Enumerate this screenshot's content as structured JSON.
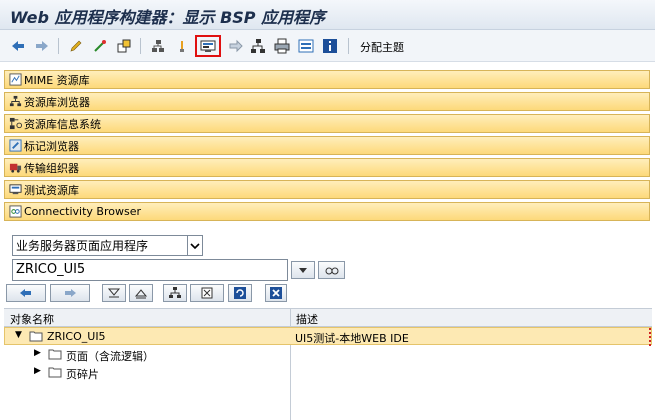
{
  "window": {
    "title": "Web 应用程序构建器：显示 BSP 应用程序"
  },
  "toolbar": {
    "icons": [
      "back-arrow-icon",
      "forward-arrow-icon",
      "edit-pencil-icon",
      "wand-icon",
      "object-list-icon",
      "hierarchy-icon",
      "lightbulb-icon",
      "test-monitor-icon",
      "navigation-icon",
      "tree-structure-icon",
      "printer-icon",
      "display-object-icon",
      "info-icon"
    ],
    "assign_theme_label": "分配主题"
  },
  "nav": {
    "items": [
      {
        "label": "MIME 资源库",
        "icon": "mime-repository-icon"
      },
      {
        "label": "资源库浏览器",
        "icon": "repository-browser-icon"
      },
      {
        "label": "资源库信息系统",
        "icon": "repository-info-system-icon"
      },
      {
        "label": "标记浏览器",
        "icon": "tag-browser-icon"
      },
      {
        "label": "传输组织器",
        "icon": "transport-organizer-icon"
      },
      {
        "label": "测试资源库",
        "icon": "test-repository-icon"
      },
      {
        "label": "Connectivity Browser",
        "icon": "connectivity-browser-icon"
      }
    ]
  },
  "object_type": {
    "selected": "业务服务器页面应用程序"
  },
  "object_name": {
    "value": "ZRICO_UI5"
  },
  "tree": {
    "headers": {
      "name": "对象名称",
      "description": "描述"
    },
    "rows": [
      {
        "name": "ZRICO_UI5",
        "description": "UI5测试-本地WEB IDE"
      },
      {
        "name": "页面（含流逻辑）",
        "description": ""
      },
      {
        "name": "页碎片",
        "description": ""
      }
    ]
  },
  "colors": {
    "nav_bar": "#fdd97a",
    "highlight_row": "#fde9b3",
    "selection_frame": "#e01010",
    "title_text": "#1d2f4d"
  }
}
